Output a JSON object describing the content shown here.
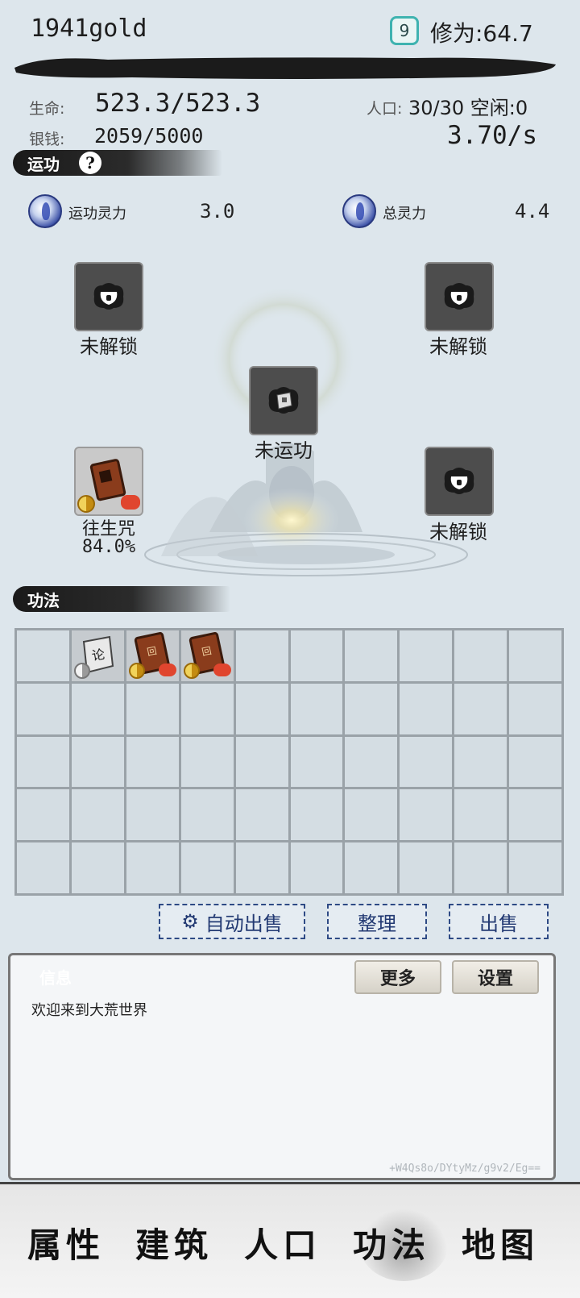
{
  "header": {
    "gold": "1941gold",
    "level_badge": "9",
    "cultivation": "修为:64.7"
  },
  "stats": {
    "life_label": "生命:",
    "life_value": "523.3/523.3",
    "money_label": "银钱:",
    "money_value": "2059/5000",
    "population_label": "人口:",
    "population_value": "30/30 空闲:0",
    "rate": "3.70/s"
  },
  "yungong": {
    "title": "运功",
    "help_icon": "question-icon",
    "gong_power_label": "运功灵力",
    "gong_power_value": "3.0",
    "total_power_label": "总灵力",
    "total_power_value": "4.4",
    "slots": [
      {
        "id": "top-left",
        "label": "未解锁",
        "state": "locked",
        "icon": "lock-icon"
      },
      {
        "id": "top-right",
        "label": "未解锁",
        "state": "locked",
        "icon": "lock-icon"
      },
      {
        "id": "center",
        "label": "未运功",
        "state": "empty",
        "icon": "scroll-icon"
      },
      {
        "id": "bottom-left",
        "label": "往生咒",
        "progress_text": "84.0%",
        "progress": 0.84,
        "state": "active",
        "icon": "book-icon"
      },
      {
        "id": "bottom-right",
        "label": "未解锁",
        "state": "locked",
        "icon": "lock-icon"
      }
    ]
  },
  "gongfa": {
    "title": "功法",
    "items": [
      {
        "slot": 1,
        "icon": "scroll-icon",
        "glyph": "论"
      },
      {
        "slot": 2,
        "icon": "book-icon",
        "glyph": "回"
      },
      {
        "slot": 3,
        "icon": "book-icon",
        "glyph": "回"
      }
    ],
    "auto_sell_label": "自动出售",
    "sort_label": "整理",
    "sell_label": "出售"
  },
  "info": {
    "title": "信息",
    "more_label": "更多",
    "settings_label": "设置",
    "message": "欢迎来到大荒世界",
    "code": "+W4Qs8o/DYtyMz/g9v2/Eg=="
  },
  "nav": {
    "items": [
      "属性",
      "建筑",
      "人口",
      "功法",
      "地图"
    ],
    "active_index": 3
  },
  "colors": {
    "background": "#dde6ec",
    "button_border": "#2e4a85",
    "tag_ink": "#1a1a1a",
    "accent_red": "#e0452e",
    "accent_gold": "#d9a520"
  }
}
